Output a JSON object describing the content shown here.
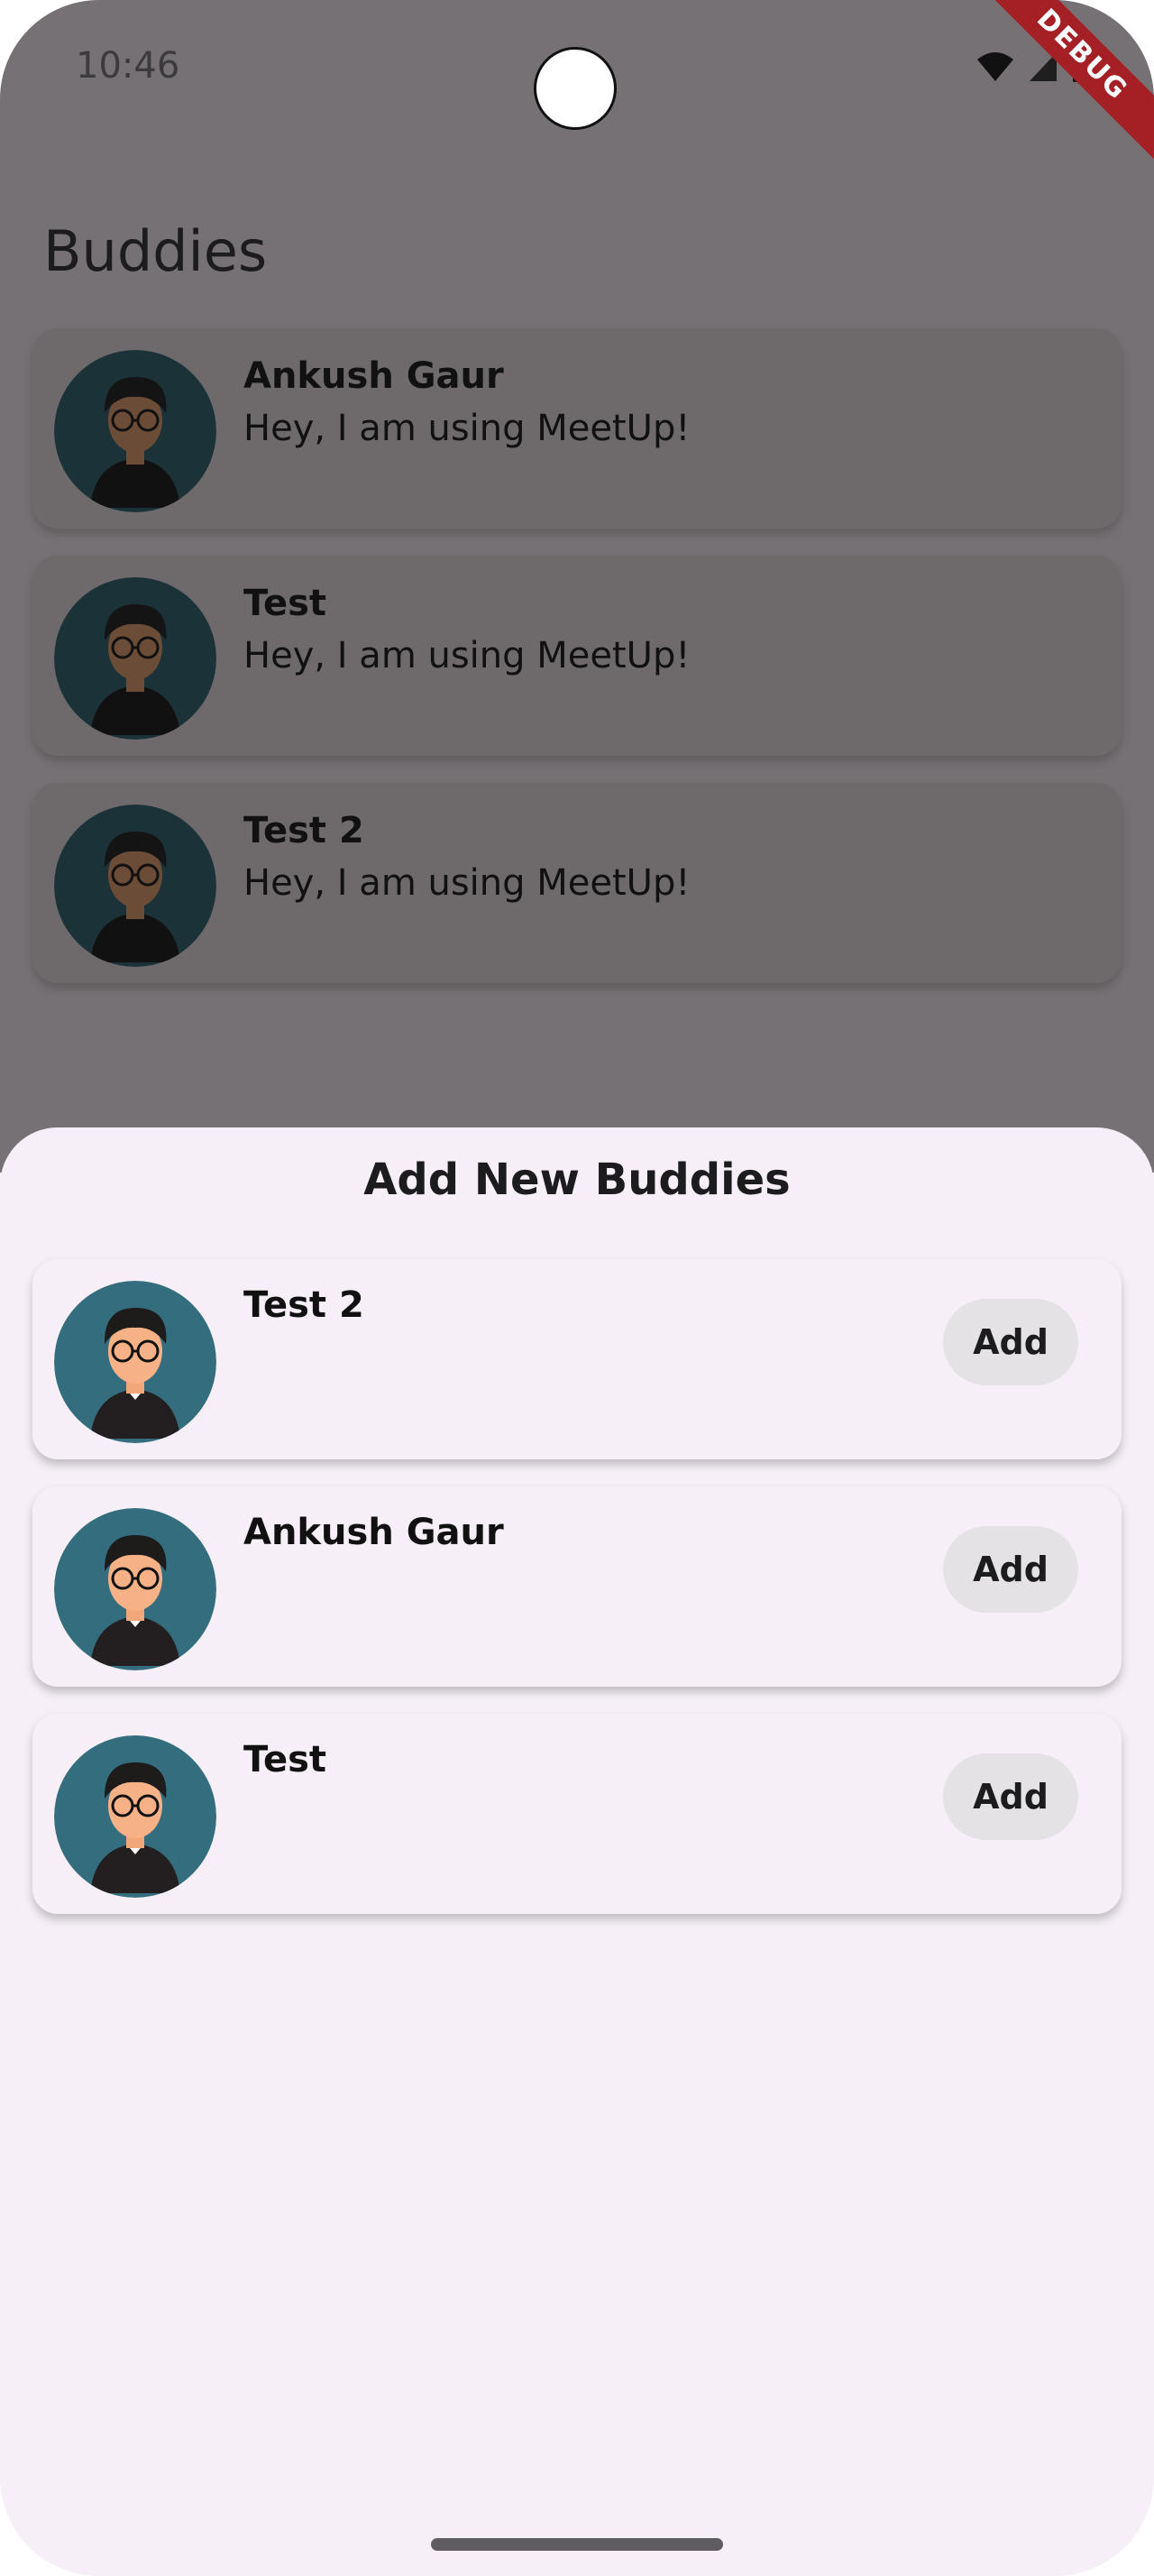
{
  "status_bar": {
    "time": "10:46",
    "icons": [
      "wifi-icon",
      "cell-signal-icon",
      "battery-icon"
    ],
    "debug_banner": "DEBUG"
  },
  "page": {
    "title": "Buddies"
  },
  "buddies": [
    {
      "name": "Ankush Gaur",
      "status": "Hey, I am using MeetUp!"
    },
    {
      "name": "Test",
      "status": "Hey, I am using MeetUp!"
    },
    {
      "name": "Test 2",
      "status": "Hey, I am using MeetUp!"
    }
  ],
  "sheet": {
    "title": "Add New Buddies",
    "candidates": [
      {
        "name": "Test 2",
        "action": "Add"
      },
      {
        "name": "Ankush Gaur",
        "action": "Add"
      },
      {
        "name": "Test",
        "action": "Add"
      }
    ]
  },
  "colors": {
    "scrim": "#767174",
    "sheet_bg": "#f6eff7",
    "debug_banner": "#a52024",
    "avatar_bg": "#336d7e"
  }
}
